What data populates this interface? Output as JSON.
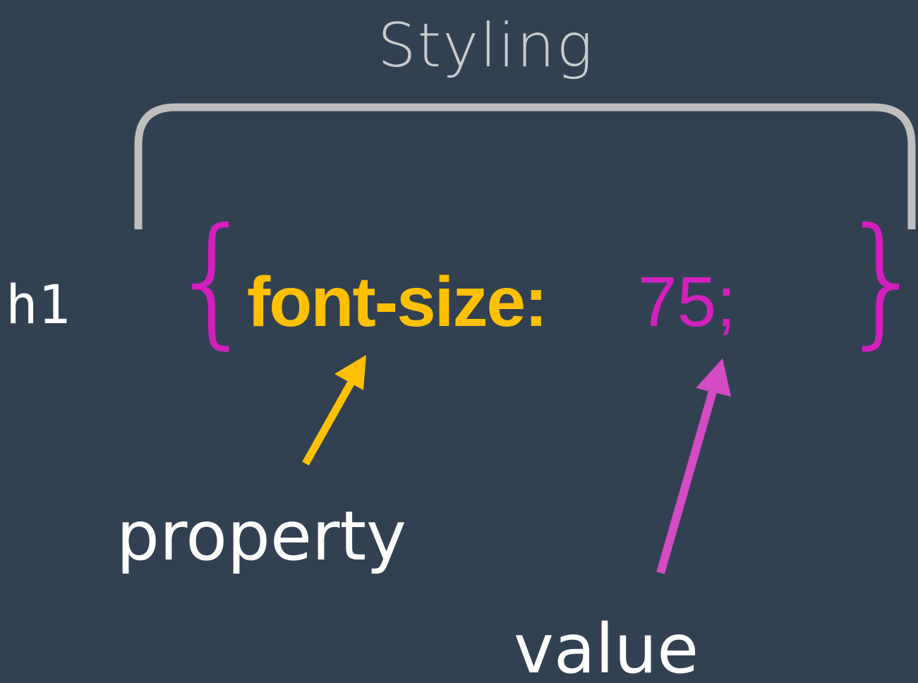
{
  "diagram": {
    "title": "Styling",
    "selector": "h1",
    "open_brace": "{",
    "property": "font-size:",
    "value": "75;",
    "close_brace": "}",
    "property_label": "property",
    "value_label": "value"
  },
  "colors": {
    "background": "#324152",
    "title": "#c9cbcc",
    "bracket": "#bfbfbf",
    "property": "#ffc000",
    "value": "#d21fbe",
    "value_arrow": "#d54bc3",
    "text": "#ffffff"
  }
}
